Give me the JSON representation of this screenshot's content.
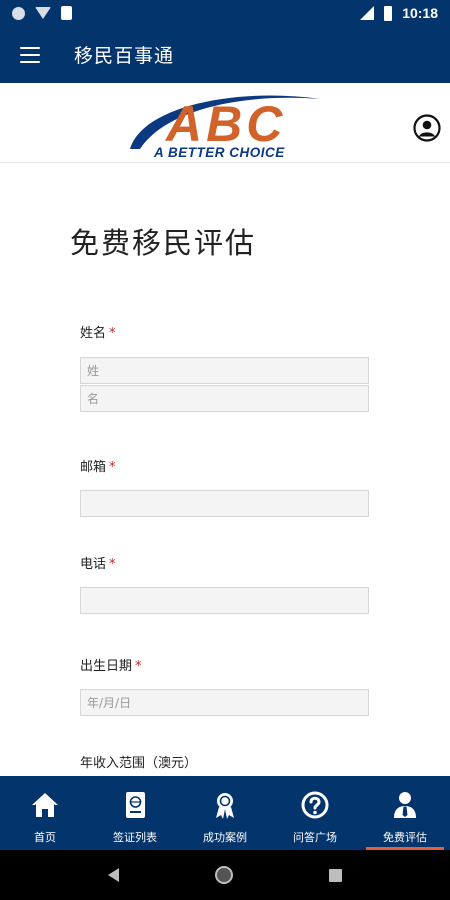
{
  "status_bar": {
    "time": "10:18",
    "icons": [
      "notification-dot-icon",
      "wifi-icon",
      "sd-card-icon",
      "signal-icon",
      "battery-icon"
    ]
  },
  "app_bar": {
    "title": "移民百事通",
    "menu_icon": "hamburger-menu-icon"
  },
  "logo": {
    "letters": "ABC",
    "tagline": "A BETTER CHOICE",
    "letters_color": "#d1622a",
    "swoosh_color": "#0b3a82"
  },
  "account_icon": "account-circle-icon",
  "page": {
    "heading": "免费移民评估"
  },
  "form": {
    "required_mark": "*",
    "name": {
      "label": "姓名",
      "surname_placeholder": "姓",
      "given_placeholder": "名"
    },
    "email": {
      "label": "邮箱",
      "placeholder": ""
    },
    "phone": {
      "label": "电话",
      "placeholder": ""
    },
    "birthdate": {
      "label": "出生日期",
      "placeholder": "年/月/日"
    },
    "income": {
      "label": "年收入范围（澳元）"
    }
  },
  "bottom_nav": {
    "items": [
      {
        "label": "首页",
        "icon": "home-icon"
      },
      {
        "label": "签证列表",
        "icon": "passport-icon"
      },
      {
        "label": "成功案例",
        "icon": "award-ribbon-icon"
      },
      {
        "label": "问答广场",
        "icon": "question-circle-icon"
      },
      {
        "label": "免费评估",
        "icon": "user-tie-icon"
      }
    ],
    "active_index": 4
  },
  "colors": {
    "primary": "#04346c",
    "accent": "#e0603a",
    "required": "#cc2222"
  }
}
